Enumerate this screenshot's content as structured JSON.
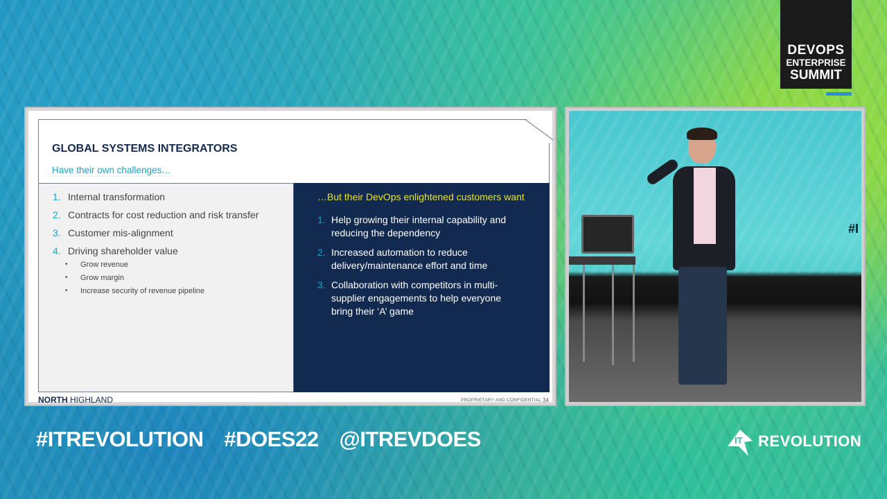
{
  "brand": {
    "badge_line1": "DEVOPS",
    "badge_line2": "ENTERPRISE",
    "badge_line3": "SUMMIT"
  },
  "slide": {
    "title": "GLOBAL SYSTEMS INTEGRATORS",
    "subtitle": "Have their own challenges…",
    "left_items": [
      {
        "num": "1.",
        "text": "Internal transformation"
      },
      {
        "num": "2.",
        "text": "Contracts for cost reduction and risk transfer"
      },
      {
        "num": "3.",
        "text": "Customer mis-alignment"
      },
      {
        "num": "4.",
        "text": "Driving shareholder value"
      }
    ],
    "sub_items": [
      {
        "bullet": "•",
        "text": "Grow revenue"
      },
      {
        "bullet": "•",
        "text": "Grow margin"
      },
      {
        "bullet": "•",
        "text": "Increase security of revenue pipeline"
      }
    ],
    "right_heading": "…But their DevOps enlightened customers want",
    "right_items": [
      {
        "num": "1.",
        "text": "Help growing their internal capability and reducing the dependency"
      },
      {
        "num": "2.",
        "text": "Increased automation to reduce delivery/maintenance effort and time"
      },
      {
        "num": "3.",
        "text": "Collaboration with competitors in multi-supplier engagements to help everyone bring their ‘A’ game"
      }
    ],
    "footer_logo_bold": "NORTH",
    "footer_logo_rest": " HIGHLAND",
    "footer_confidential": "PROPRIETARY AND CONFIDENTIAL",
    "page_number": "34"
  },
  "camera": {
    "background_text": "#I"
  },
  "hashtags": {
    "tag1": "#ITREVOLUTION",
    "tag2": "#DOES22",
    "tag3": "@ITREVDOES"
  },
  "itrev_logo": {
    "mark_text": "IT",
    "wordmark": "REVOLUTION"
  },
  "colors": {
    "slide_navy": "#122a4f",
    "slide_accent": "#1aa3c5",
    "slide_heading_yellow": "#e8e22a",
    "badge_bg": "#1b1b1b",
    "badge_bar": "#2f8fd1"
  }
}
